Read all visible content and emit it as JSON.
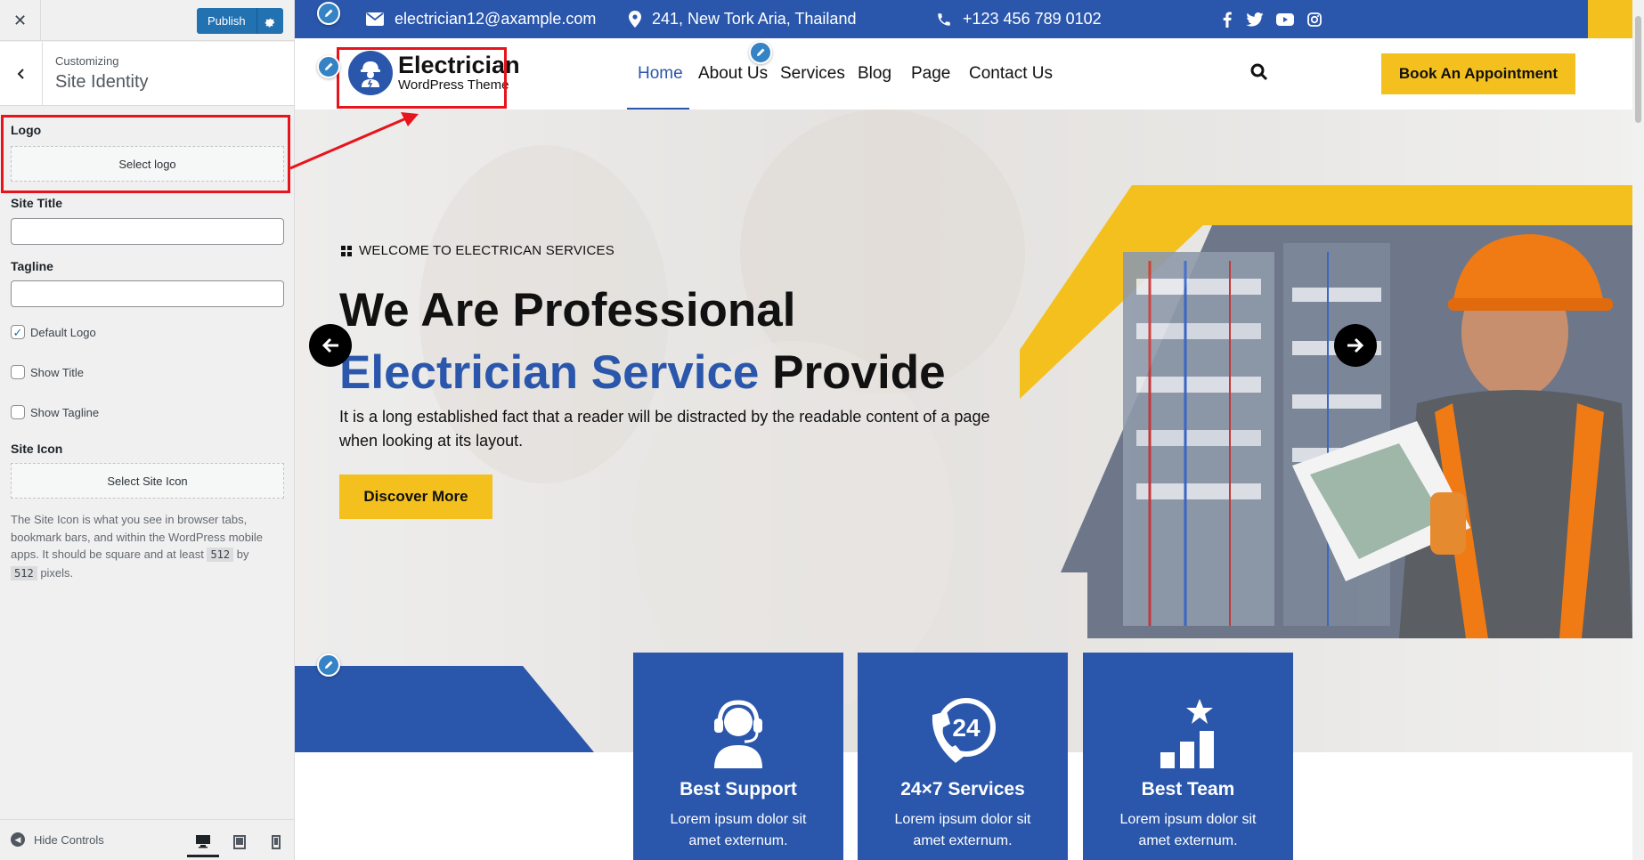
{
  "customizer": {
    "publish_label": "Publish",
    "breadcrumb": "Customizing",
    "section_title": "Site Identity",
    "logo_label": "Logo",
    "select_logo": "Select logo",
    "site_title_label": "Site Title",
    "site_title_value": "",
    "tagline_label": "Tagline",
    "tagline_value": "",
    "default_logo": "Default Logo",
    "show_title": "Show Title",
    "show_tagline": "Show Tagline",
    "site_icon_label": "Site Icon",
    "select_site_icon": "Select Site Icon",
    "site_icon_desc_1": "The Site Icon is what you see in browser tabs, bookmark bars, and within the WordPress mobile apps. It should be square and at least",
    "size_a": "512",
    "site_icon_by": "by",
    "size_b": "512",
    "site_icon_desc_2": "pixels.",
    "hide_controls": "Hide Controls"
  },
  "topbar": {
    "email": "electrician12@axample.com",
    "address": "241, New Tork Aria, Thailand",
    "phone": "+123 456 789 0102",
    "social_icons": [
      "facebook-icon",
      "twitter-icon",
      "youtube-icon",
      "instagram-icon"
    ]
  },
  "site": {
    "logo_title": "Electrician",
    "logo_sub": "WordPress Theme",
    "nav": [
      "Home",
      "About Us",
      "Services",
      "Blog",
      "Page",
      "Contact Us"
    ],
    "active_nav": "Home",
    "book_button": "Book An Appointment"
  },
  "hero": {
    "welcome": "WELCOME TO ELECTRICAN SERVICES",
    "heading_line1": "We Are Professional",
    "heading_blue": "Electrician Service",
    "heading_end": "Provide",
    "paragraph": "It is a long established fact that a reader will be distracted by the readable content of a page when looking at its layout.",
    "button": "Discover More"
  },
  "features": [
    {
      "title": "Best Support",
      "desc": "Lorem ipsum dolor sit amet externum.",
      "icon": "headset-icon"
    },
    {
      "title": "24×7 Services",
      "desc": "Lorem ipsum dolor sit amet externum.",
      "icon": "phone-24-icon"
    },
    {
      "title": "Best Team",
      "desc": "Lorem ipsum dolor sit amet externum.",
      "icon": "star-bars-icon"
    }
  ],
  "colors": {
    "brand_blue": "#2a57ac",
    "accent_yellow": "#f4c01e",
    "wp_blue": "#2271b1",
    "highlight_red": "#e8141c"
  }
}
